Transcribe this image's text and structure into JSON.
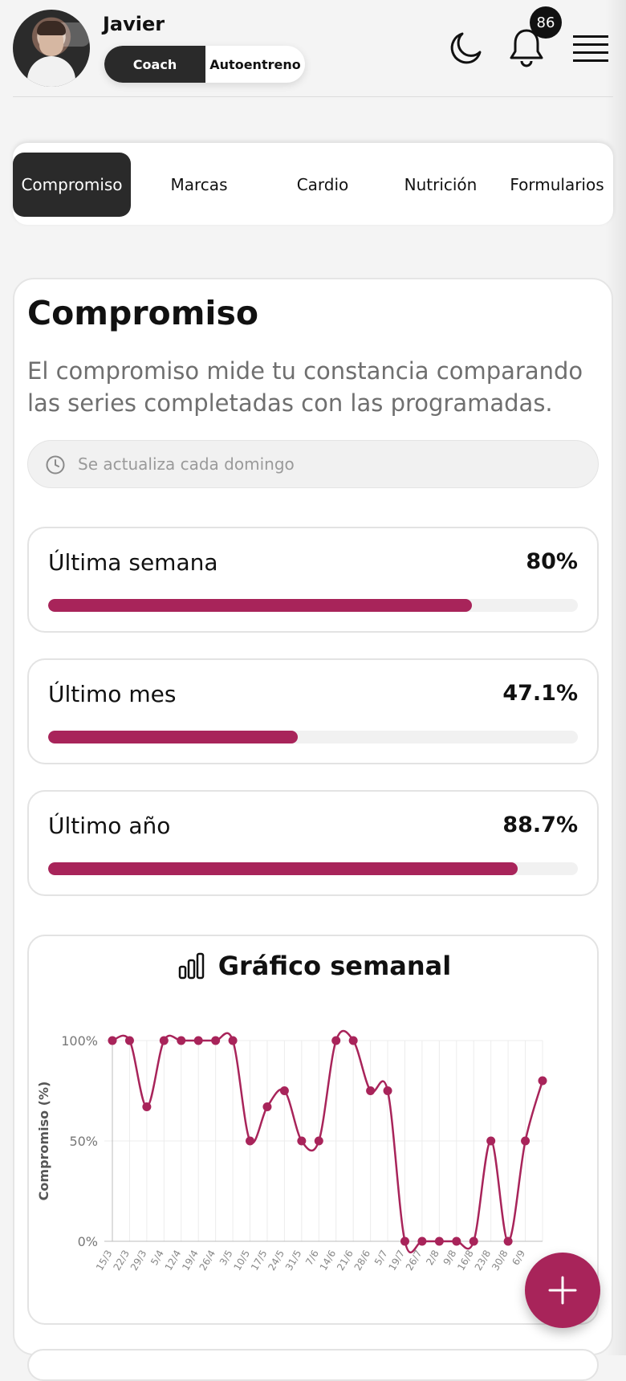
{
  "user": {
    "name": "Javier"
  },
  "role_toggle": {
    "options": [
      "Coach",
      "Autoentreno"
    ],
    "selected": "Coach"
  },
  "notifications": {
    "count": "86"
  },
  "icons": {
    "theme": "moon-icon",
    "notifications": "bell-icon",
    "menu": "hamburger-menu-icon",
    "clock": "clock-icon",
    "chart": "bar-chart-icon",
    "fab": "plus-icon"
  },
  "tabs": [
    {
      "label": "Compromiso",
      "active": true
    },
    {
      "label": "Marcas",
      "active": false
    },
    {
      "label": "Cardio",
      "active": false
    },
    {
      "label": "Nutrición",
      "active": false
    },
    {
      "label": "Formularios",
      "active": false
    }
  ],
  "section": {
    "title": "Compromiso",
    "description": "El compromiso mide tu constancia comparando las series completadas con las programadas.",
    "update_note": "Se actualiza cada domingo"
  },
  "stats": [
    {
      "label": "Última semana",
      "value": "80%",
      "progress": 0.8
    },
    {
      "label": "Último mes",
      "value": "47.1%",
      "progress": 0.471
    },
    {
      "label": "Último año",
      "value": "88.7%",
      "progress": 0.887
    }
  ],
  "colors": {
    "accent": "#a8245a",
    "dark": "#2a2a2a"
  },
  "chart_data": {
    "type": "line",
    "title": "Gráfico semanal",
    "ylabel": "Compromiso (%)",
    "xlabel": "",
    "ylim": [
      0,
      100
    ],
    "y_ticks": [
      "0%",
      "50%",
      "100%"
    ],
    "grid": true,
    "categories": [
      "15/3",
      "22/3",
      "29/3",
      "5/4",
      "12/4",
      "19/4",
      "26/4",
      "3/5",
      "10/5",
      "17/5",
      "24/5",
      "31/5",
      "7/6",
      "14/6",
      "21/6",
      "28/6",
      "5/7",
      "19/7",
      "26/7",
      "2/8",
      "9/8",
      "16/8",
      "23/8",
      "30/8",
      "6/9"
    ],
    "series": [
      {
        "name": "",
        "values": [
          100,
          100,
          67,
          100,
          100,
          100,
          100,
          100,
          50,
          67,
          75,
          50,
          50,
          100,
          100,
          75,
          75,
          0,
          0,
          0,
          0,
          0,
          50,
          0,
          50,
          80
        ]
      }
    ]
  }
}
